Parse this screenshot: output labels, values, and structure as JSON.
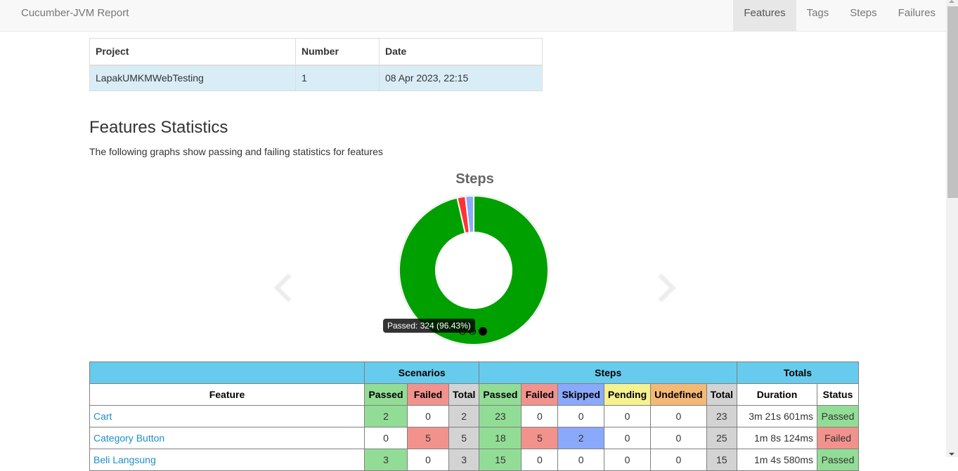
{
  "navbar": {
    "brand": "Cucumber-JVM Report",
    "items": [
      {
        "label": "Features",
        "active": true
      },
      {
        "label": "Tags",
        "active": false
      },
      {
        "label": "Steps",
        "active": false
      },
      {
        "label": "Failures",
        "active": false
      }
    ]
  },
  "build_info": {
    "headers": [
      "Project",
      "Number",
      "Date"
    ],
    "row": [
      "LapakUMKMWebTesting",
      "1",
      "08 Apr 2023, 22:15"
    ]
  },
  "section": {
    "title": "Features Statistics",
    "description": "The following graphs show passing and failing statistics for features"
  },
  "carousel": {
    "prev_icon": "chevron-left-icon",
    "next_icon": "chevron-right-icon",
    "slide_count": 3,
    "active_slide": 3
  },
  "chart_data": {
    "type": "pie",
    "title": "Steps",
    "donut": true,
    "slices": [
      {
        "label": "Passed",
        "value": 324,
        "color": "#00a000"
      },
      {
        "label": "Failed",
        "value": 6,
        "color": "#ff3333"
      },
      {
        "label": "Skipped",
        "value": 6,
        "color": "#88aaff"
      }
    ],
    "tooltip": "Passed: 324 (96.43%)"
  },
  "stats_table": {
    "group_headers": {
      "scenarios": "Scenarios",
      "steps": "Steps",
      "totals": "Totals"
    },
    "columns": {
      "feature": "Feature",
      "sc_passed": "Passed",
      "sc_failed": "Failed",
      "sc_total": "Total",
      "st_passed": "Passed",
      "st_failed": "Failed",
      "st_skipped": "Skipped",
      "st_pending": "Pending",
      "st_undefined": "Undefined",
      "st_total": "Total",
      "duration": "Duration",
      "status": "Status"
    },
    "rows": [
      {
        "feature": "Cart",
        "sc_passed": "2",
        "sc_failed": "0",
        "sc_total": "2",
        "st_passed": "23",
        "st_failed": "0",
        "st_skipped": "0",
        "st_pending": "0",
        "st_undefined": "0",
        "st_total": "23",
        "duration": "3m 21s 601ms",
        "status": "Passed"
      },
      {
        "feature": "Category Button",
        "sc_passed": "0",
        "sc_failed": "5",
        "sc_total": "5",
        "st_passed": "18",
        "st_failed": "5",
        "st_skipped": "2",
        "st_pending": "0",
        "st_undefined": "0",
        "st_total": "25",
        "duration": "1m 8s 124ms",
        "status": "Failed"
      },
      {
        "feature": "Beli Langsung",
        "sc_passed": "3",
        "sc_failed": "0",
        "sc_total": "3",
        "st_passed": "15",
        "st_failed": "0",
        "st_skipped": "0",
        "st_pending": "0",
        "st_undefined": "0",
        "st_total": "15",
        "duration": "1m 4s 580ms",
        "status": "Passed"
      }
    ]
  }
}
